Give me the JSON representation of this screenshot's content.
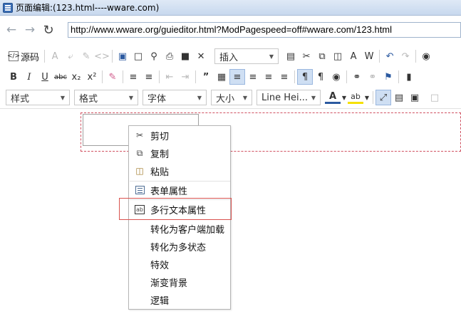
{
  "window": {
    "title": "页面编辑:(123.html----wware.com)"
  },
  "browser": {
    "back_icon": "back-arrow-icon",
    "forward_icon": "forward-arrow-icon",
    "reload_icon": "reload-icon",
    "url": "http://www.wware.org/guieditor.html?ModPagespeed=off#wware.com/123.html"
  },
  "toolbar": {
    "source_label": "源码",
    "insert_combo": "插入",
    "style_combo": "样式",
    "format_combo": "格式",
    "font_combo": "字体",
    "size_combo": "大小",
    "lineheight_combo": "Line Hei...",
    "bold_label": "B",
    "italic_label": "I",
    "underline_label": "U",
    "strike_label": "abc",
    "subscript_label": "x₂",
    "superscript_label": "x²",
    "text_color_label": "A",
    "highlight_label": "ab"
  },
  "context_menu": {
    "items": [
      {
        "label": "剪切",
        "icon": "scissors-icon"
      },
      {
        "label": "复制",
        "icon": "copy-icon"
      },
      {
        "label": "粘贴",
        "icon": "paste-icon"
      },
      {
        "label": "表单属性",
        "icon": "form-properties-icon"
      },
      {
        "label": "多行文本属性",
        "icon": "textarea-properties-icon"
      },
      {
        "label": "转化为客户端加载",
        "icon": ""
      },
      {
        "label": "转化为多状态",
        "icon": ""
      },
      {
        "label": "特效",
        "icon": ""
      },
      {
        "label": "渐变背景",
        "icon": ""
      },
      {
        "label": "逻辑",
        "icon": ""
      }
    ],
    "highlighted_item": "多行文本属性"
  },
  "colors": {
    "highlight_border": "#d9534f",
    "edit_region_border": "#d05060",
    "active_toolbar_bg": "#cfdff3"
  }
}
